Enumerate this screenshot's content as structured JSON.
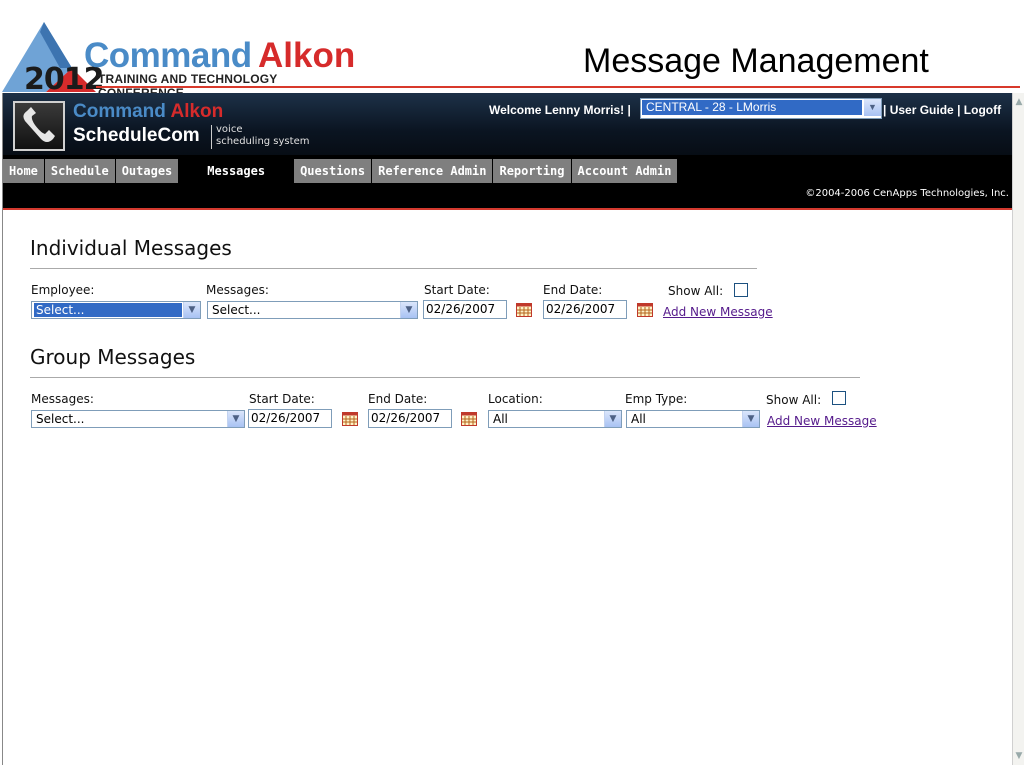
{
  "slide": {
    "logo_year": "2012",
    "logo_word1": "Command",
    "logo_word2": "Alkon",
    "logo_subtitle": "TRAINING AND TECHNOLOGY CONFERENCE",
    "title": "Message Management"
  },
  "app": {
    "brand_command": "Command",
    "brand_alkon": "Alkon",
    "brand_product": "ScheduleCom",
    "brand_tag_line1": "voice",
    "brand_tag_line2": "scheduling system",
    "welcome": "Welcome Lenny Morris! |",
    "region": "CENTRAL - 28 - LMorris",
    "user_guide": "User Guide",
    "logoff": "Logoff",
    "sep": "|",
    "copyright": "©2004-2006 CenApps Technologies, Inc."
  },
  "nav": {
    "tabs": [
      "Home",
      "Schedule",
      "Outages",
      "Messages",
      "Questions",
      "Reference Admin",
      "Reporting",
      "Account Admin"
    ],
    "active": "Messages"
  },
  "individual": {
    "title": "Individual Messages",
    "employee_label": "Employee:",
    "employee_value": "Select...",
    "messages_label": "Messages:",
    "messages_value": "Select...",
    "start_label": "Start Date:",
    "start_value": "02/26/2007",
    "end_label": "End Date:",
    "end_value": "02/26/2007",
    "show_all_label": "Show All:",
    "add_link": "Add New Message"
  },
  "group": {
    "title": "Group Messages",
    "messages_label": "Messages:",
    "messages_value": "Select...",
    "start_label": "Start Date:",
    "start_value": "02/26/2007",
    "end_label": "End Date:",
    "end_value": "02/26/2007",
    "location_label": "Location:",
    "location_value": "All",
    "emp_type_label": "Emp Type:",
    "emp_type_value": "All",
    "show_all_label": "Show All:",
    "add_link": "Add New Message"
  },
  "colors": {
    "accent_red": "#d43a2f",
    "brand_blue": "#4a8bc7",
    "select_highlight": "#316ac5",
    "tab_gray": "#7f7f7f"
  }
}
